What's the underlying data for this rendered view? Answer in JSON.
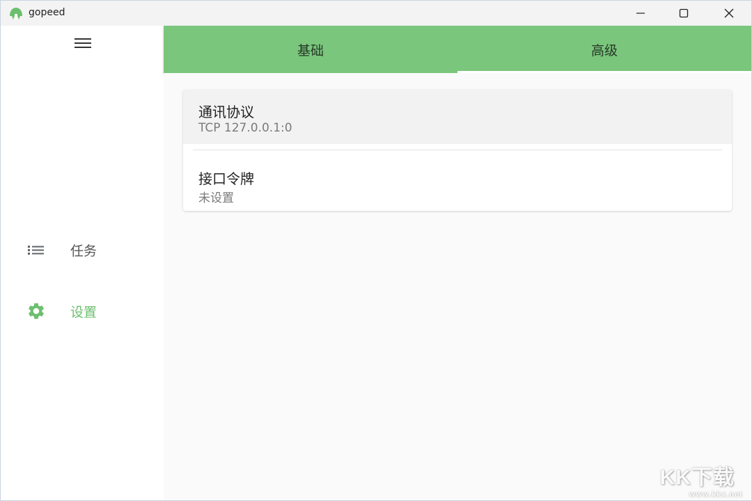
{
  "window": {
    "title": "gopeed",
    "logo_icon": "gopeed-logo-icon",
    "controls": {
      "minimize_icon": "minimize-icon",
      "maximize_icon": "maximize-icon",
      "close_icon": "close-icon"
    }
  },
  "colors": {
    "accent": "#7bc67d",
    "accent_text": "#6cbf6e",
    "tab_text": "#263826"
  },
  "sidebar": {
    "menu_icon": "hamburger-menu-icon",
    "items": [
      {
        "label": "任务",
        "icon": "list-icon",
        "active": false
      },
      {
        "label": "设置",
        "icon": "gear-icon",
        "active": true
      }
    ]
  },
  "tabs": [
    {
      "label": "基础",
      "selected": false
    },
    {
      "label": "高级",
      "selected": true
    }
  ],
  "settings": [
    {
      "title": "通讯协议",
      "value": "TCP 127.0.0.1:0"
    },
    {
      "title": "接口令牌",
      "value": "未设置"
    }
  ],
  "watermark": {
    "brand": "KK下载",
    "url": "www.kkx.net"
  }
}
